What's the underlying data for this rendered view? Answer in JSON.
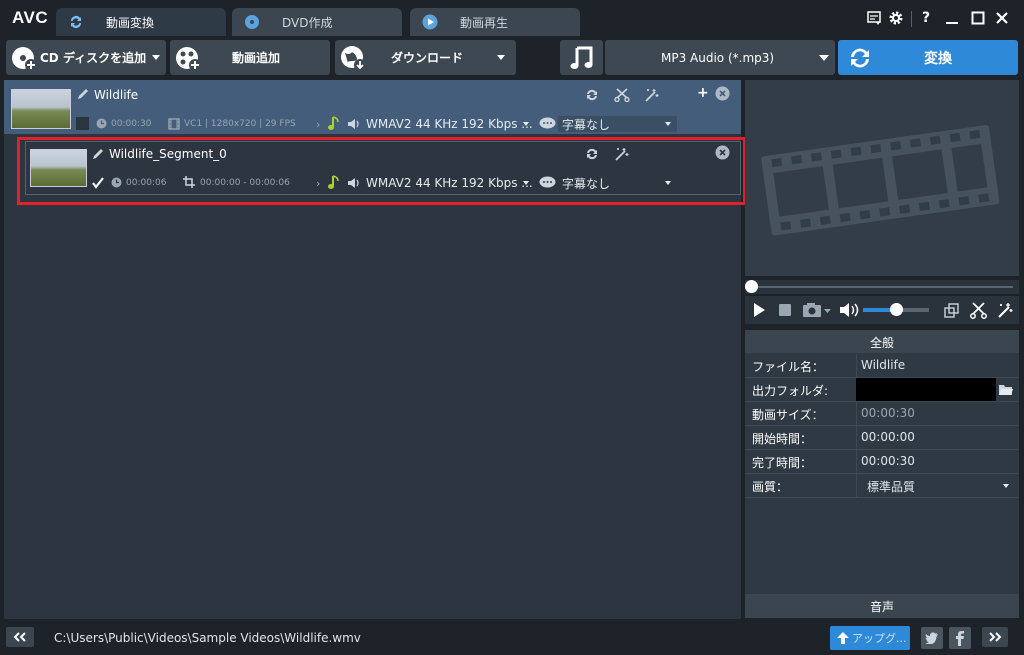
{
  "app": {
    "logo": "AVC"
  },
  "tabs": [
    {
      "label": "動画変換",
      "icon": "convert-icon",
      "active": true
    },
    {
      "label": "DVD作成",
      "icon": "disc-icon",
      "active": false
    },
    {
      "label": "動画再生",
      "icon": "play-icon",
      "active": false
    }
  ],
  "window": {
    "help": "?"
  },
  "toolbar": {
    "add_cd": "CD ディスクを追加",
    "add_video": "動画追加",
    "download": "ダウンロード",
    "profile": "MP3 Audio (*.mp3)",
    "convert": "変換"
  },
  "items": [
    {
      "name": "Wildlife",
      "duration": "00:00:30",
      "video_info": "VC1 | 1280x720 | 29 FPS",
      "audio": "WMAV2 44 KHz 192 Kbps ...",
      "subtitle": "字幕なし",
      "checked": false
    },
    {
      "name": "Wildlife_Segment_0",
      "duration": "00:00:06",
      "range": "00:00:00 - 00:00:06",
      "audio": "WMAV2 44 KHz 192 Kbps ...",
      "subtitle": "字幕なし",
      "checked": true
    }
  ],
  "properties": {
    "section_general": "全般",
    "section_audio": "音声",
    "rows": [
      {
        "label": "ファイル名：",
        "value": "Wildlife"
      },
      {
        "label": "出力フォルダ:",
        "value": ""
      },
      {
        "label": "動画サイズ：",
        "value": "00:00:30"
      },
      {
        "label": "開始時間：",
        "value": "00:00:00"
      },
      {
        "label": "完了時間：",
        "value": "00:00:30"
      },
      {
        "label": "画質：",
        "value": "標準品質"
      }
    ]
  },
  "status": {
    "path": "C:\\Users\\Public\\Videos\\Sample Videos\\Wildlife.wmv",
    "upgrade": "アップグ..."
  },
  "player": {
    "volume": 0.5,
    "position": 0.0
  },
  "colors": {
    "accent": "#2e8ad8",
    "highlight": "#e0202a",
    "selected_row": "#435d7a"
  }
}
